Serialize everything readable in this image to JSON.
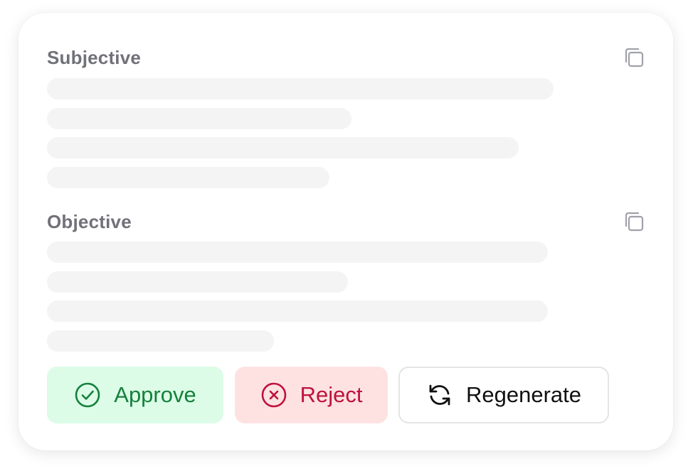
{
  "sections": [
    {
      "title": "Subjective",
      "copy_icon": "copy-icon"
    },
    {
      "title": "Objective",
      "copy_icon": "copy-icon"
    }
  ],
  "actions": {
    "approve_label": "Approve",
    "approve_icon": "check-circle-icon",
    "reject_label": "Reject",
    "reject_icon": "x-circle-icon",
    "regenerate_label": "Regenerate",
    "regenerate_icon": "refresh-icon"
  },
  "colors": {
    "approve_bg": "#dcfce7",
    "approve_text": "#15803d",
    "reject_bg": "#fee2e2",
    "reject_text": "#be123c",
    "heading": "#71717a",
    "skeleton": "#f4f4f5"
  }
}
